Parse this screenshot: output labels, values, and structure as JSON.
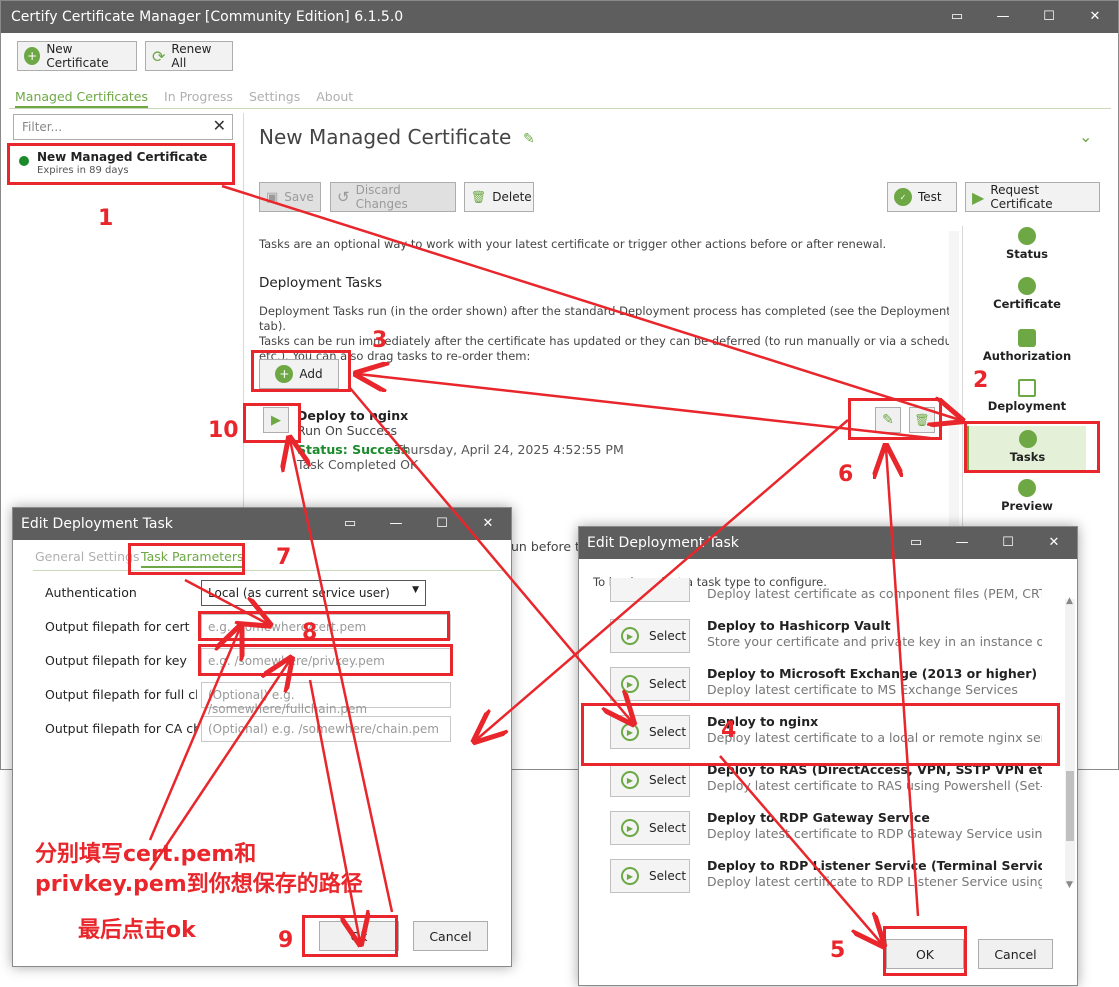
{
  "main": {
    "title": "Certify Certificate Manager [Community Edition] 6.1.5.0",
    "new_cert": "New Certificate",
    "renew_all": "Renew All",
    "tabs": [
      "Managed Certificates",
      "In Progress",
      "Settings",
      "About"
    ],
    "filter_placeholder": "Filter...",
    "item_title": "New Managed Certificate",
    "item_sub": "Expires in 89 days",
    "heading": "New Managed Certificate",
    "save": "Save",
    "discard": "Discard Changes",
    "delete": "Delete",
    "test": "Test",
    "request": "Request Certificate",
    "intro": "Tasks are an optional way to work with your latest certificate or trigger other actions before or after renewal.",
    "dt_heading": "Deployment Tasks",
    "dt_desc1": "Deployment Tasks run (in the order shown) after the standard Deployment process has completed (see the Deployment tab).",
    "dt_desc2": "Tasks can be run immediately after the certificate has updated or they can be deferred (to run manually or via a scheduled task",
    "dt_desc3": "etc.). You can also drag tasks to re-order them:",
    "add": "Add",
    "task_title": "Deploy to nginx",
    "task_run": "Run On Success",
    "status_label": "Status: Success",
    "status_date": "Thursday, April 24, 2025 4:52:55 PM",
    "task_completed": "Task Completed OK",
    "partial_text": "un before th",
    "nav": [
      "Status",
      "Certificate",
      "Authorization",
      "Deployment",
      "Tasks",
      "Preview"
    ]
  },
  "edit_left": {
    "title": "Edit Deployment Task",
    "tab_general": "General Settings",
    "tab_params": "Task Parameters",
    "auth_label": "Authentication",
    "auth_value": "Local (as current service user)",
    "cert_label": "Output filepath for cert",
    "cert_ph": "e.g. /somewhere/cert.pem",
    "key_label": "Output filepath for key",
    "key_ph": "e.g. /somewhere/privkey.pem",
    "full_label": "Output filepath for full chai",
    "full_ph": "(Optional) e.g. /somewhere/fullchain.pem",
    "ca_label": "Output filepath for CA chai",
    "ca_ph": "(Optional) e.g. /somewhere/chain.pem",
    "ok": "Ok",
    "cancel": "Cancel"
  },
  "edit_right": {
    "title": "Edit Deployment Task",
    "intro": "To begin, select a task type to configure.",
    "partial": "Deploy latest certificate as component files (PEM, CRT, KE",
    "select": "Select",
    "rows": [
      {
        "t": "Deploy to Hashicorp Vault",
        "s": "Store your certificate and private key in an instance of Has"
      },
      {
        "t": "Deploy to Microsoft Exchange (2013 or higher)",
        "s": "Deploy latest certificate to MS Exchange Services"
      },
      {
        "t": "Deploy to nginx",
        "s": "Deploy latest certificate to a local or remote nginx server"
      },
      {
        "t": "Deploy to RAS (DirectAccess, VPN, SSTP VPN etc)",
        "s": "Deploy latest certificate to RAS using Powershell (Set-Rem"
      },
      {
        "t": "Deploy to RDP Gateway Service",
        "s": "Deploy latest certificate to RDP Gateway Service using Pov"
      },
      {
        "t": "Deploy to RDP Listener Service (Terminal Services)",
        "s": "Deploy latest certificate to RDP Listener Service using Pow"
      }
    ],
    "ok": "OK",
    "cancel": "Cancel"
  },
  "annotations": {
    "n1": "1",
    "n2": "2",
    "n3": "3",
    "n4": "4",
    "n5": "5",
    "n6": "6",
    "n7": "7",
    "n8": "8",
    "n9": "9",
    "n10": "10",
    "note1": "分别填写cert.pem和",
    "note2": "privkey.pem到你想保存的路径",
    "note3": "最后点击ok"
  },
  "colors": {
    "accent": "#6da845",
    "annotation": "#e8262b",
    "titlebar": "#5e5e5e"
  }
}
